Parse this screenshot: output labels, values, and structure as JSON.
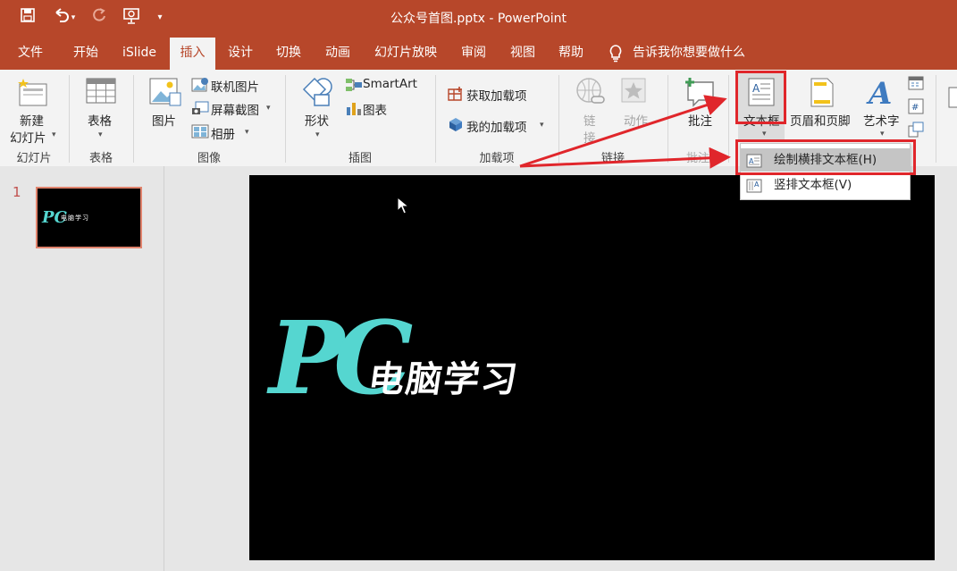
{
  "window": {
    "title": "公众号首图.pptx  -  PowerPoint"
  },
  "qat": {
    "dropdown_glyph": "▾"
  },
  "tabs": [
    {
      "label": "文件"
    },
    {
      "label": "开始"
    },
    {
      "label": "iSlide"
    },
    {
      "label": "插入"
    },
    {
      "label": "设计"
    },
    {
      "label": "切换"
    },
    {
      "label": "动画"
    },
    {
      "label": "幻灯片放映"
    },
    {
      "label": "审阅"
    },
    {
      "label": "视图"
    },
    {
      "label": "帮助"
    }
  ],
  "tell_me": "告诉我你想要做什么",
  "ribbon": {
    "slides": {
      "new_slide": "新建",
      "new_slide_2": "幻灯片",
      "group": "幻灯片"
    },
    "tables": {
      "table": "表格",
      "group": "表格"
    },
    "images": {
      "picture": "图片",
      "online": "联机图片",
      "screenshot": "屏幕截图",
      "album": "相册",
      "group": "图像"
    },
    "illustrations": {
      "shapes": "形状",
      "smartart": "SmartArt",
      "chart": "图表",
      "group": "插图"
    },
    "addins": {
      "get": "获取加载项",
      "mine": "我的加载项",
      "group": "加载项"
    },
    "links": {
      "link_1": "链",
      "link_2": "接",
      "action": "动作",
      "group": "链接"
    },
    "comments": {
      "comment": "批注",
      "group": "批注"
    },
    "text": {
      "textbox": "文本框",
      "header_footer": "页眉和页脚",
      "wordart": "艺术字"
    }
  },
  "dropdown": {
    "items": [
      {
        "label": "绘制横排文本框(H)"
      },
      {
        "label": "竖排文本框(V)"
      }
    ]
  },
  "slide_pane": {
    "number": "1"
  },
  "slide": {
    "logo": "PC",
    "logo_text": "电脑学习"
  },
  "colors": {
    "accent": "#b7472a",
    "logo": "#55d6d0",
    "annotation": "#e0262b"
  }
}
